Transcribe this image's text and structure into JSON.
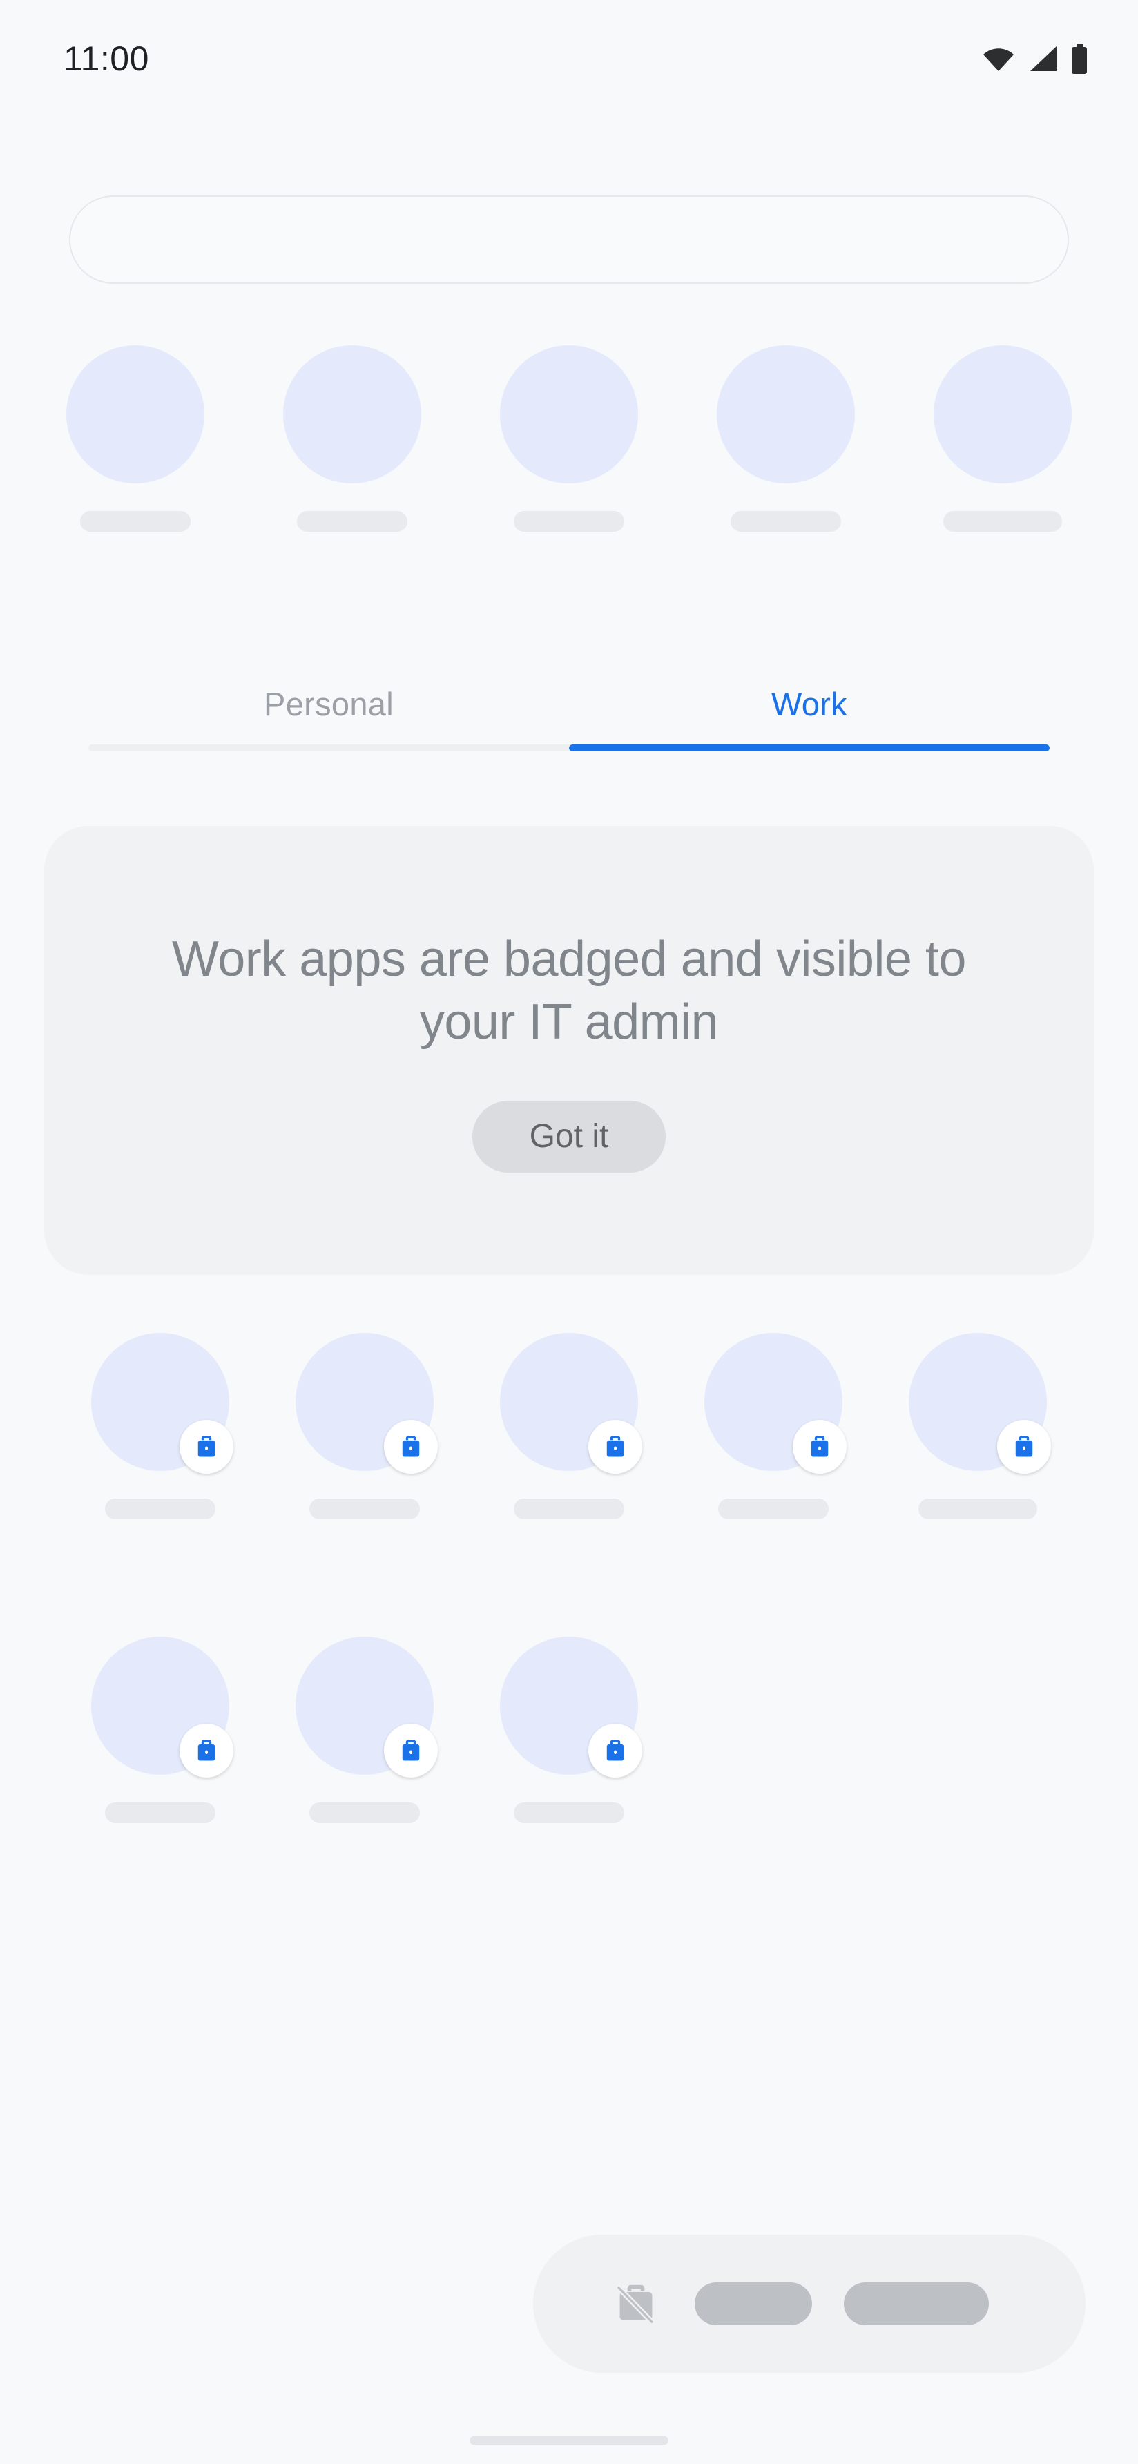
{
  "status_bar": {
    "clock": "11:00",
    "icons": [
      {
        "name": "wifi-icon",
        "label": "Wi-Fi"
      },
      {
        "name": "cellular-signal-icon",
        "label": "Mobile signal"
      },
      {
        "name": "battery-icon",
        "label": "Battery"
      }
    ]
  },
  "search": {
    "value": "",
    "placeholder": ""
  },
  "predicted_apps": [
    {
      "label": "",
      "badged": false
    },
    {
      "label": "",
      "badged": false
    },
    {
      "label": "",
      "badged": false
    },
    {
      "label": "",
      "badged": false
    },
    {
      "label": "",
      "badged": false
    }
  ],
  "tabs": {
    "items": [
      {
        "label": "Personal",
        "active": false
      },
      {
        "label": "Work",
        "active": true
      }
    ],
    "active_index": 1
  },
  "info_card": {
    "title": "Work apps are badged and visible to your IT admin",
    "button_label": "Got it"
  },
  "app_grid": {
    "row1": [
      {
        "label": "",
        "badged": true
      },
      {
        "label": "",
        "badged": true
      },
      {
        "label": "",
        "badged": true
      },
      {
        "label": "",
        "badged": true
      },
      {
        "label": "",
        "badged": true
      }
    ],
    "row2": [
      {
        "label": "",
        "badged": true
      },
      {
        "label": "",
        "badged": true
      },
      {
        "label": "",
        "badged": true
      }
    ]
  },
  "work_bar": {
    "icon": "work-profile-off-icon",
    "pill_1": "",
    "pill_2": ""
  },
  "home_indicator": {
    "label": ""
  },
  "colors": {
    "page_background": "#F7F9FB",
    "accent_blue": "#1B72E8",
    "app_icon_placeholder": "#E4EAFB",
    "label_placeholder": "#E8EAED",
    "card_background": "#F1F2F4",
    "card_text": "#80868B",
    "button_background": "#DADCE0",
    "button_text": "#5F6368",
    "inactive_tab": "#9AA0A6",
    "status_icon": "#2C2E2F",
    "work_bar_background": "#F0F1F3",
    "work_bar_pill": "#BDC1C6"
  }
}
